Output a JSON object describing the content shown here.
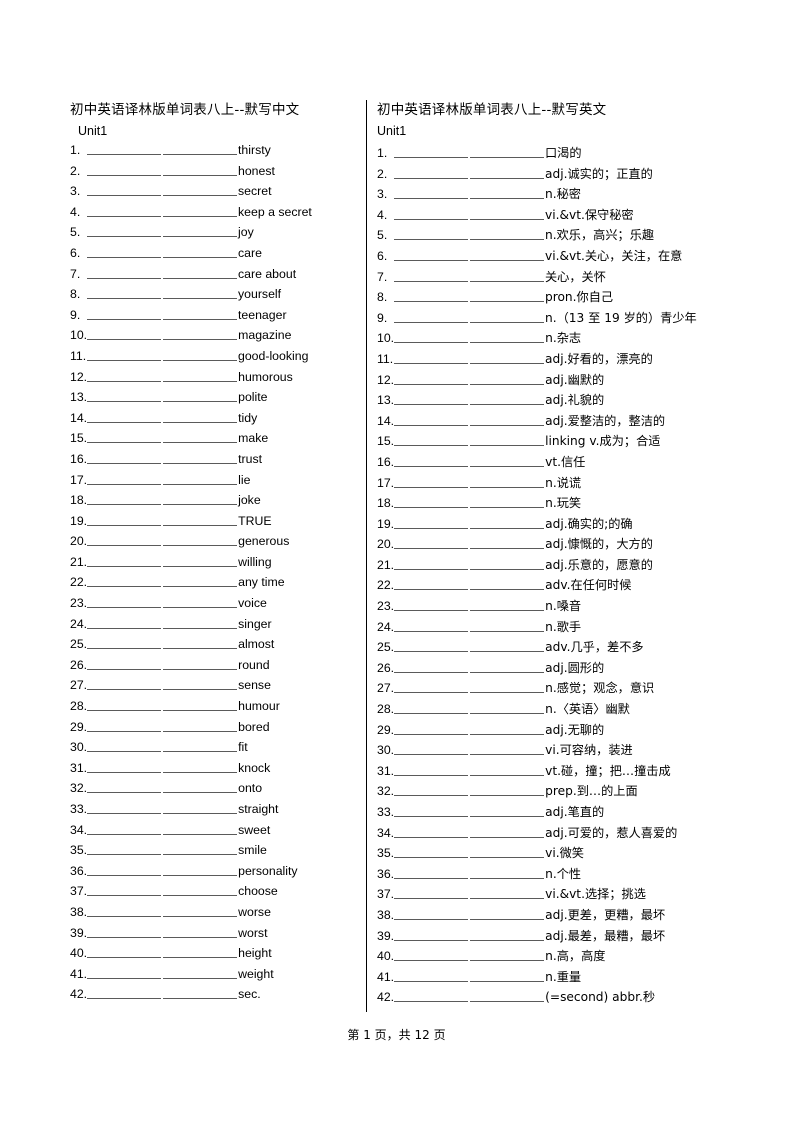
{
  "document": {
    "footer": "第 1 页，共 12 页"
  },
  "left_column": {
    "title": "初中英语译林版单词表八上--默写中文",
    "unit": "Unit1",
    "entries": [
      {
        "num": "1.",
        "text": "thirsty"
      },
      {
        "num": "2.",
        "text": "honest"
      },
      {
        "num": "3.",
        "text": "secret"
      },
      {
        "num": "4.",
        "text": "keep a secret"
      },
      {
        "num": "5.",
        "text": "joy"
      },
      {
        "num": "6.",
        "text": "care"
      },
      {
        "num": "7.",
        "text": "care about"
      },
      {
        "num": "8.",
        "text": "yourself"
      },
      {
        "num": "9.",
        "text": "teenager"
      },
      {
        "num": "10.",
        "text": "magazine"
      },
      {
        "num": "11.",
        "text": "good-looking"
      },
      {
        "num": "12.",
        "text": "humorous"
      },
      {
        "num": "13.",
        "text": "polite"
      },
      {
        "num": "14.",
        "text": "tidy"
      },
      {
        "num": "15.",
        "text": "make"
      },
      {
        "num": "16.",
        "text": "trust"
      },
      {
        "num": "17.",
        "text": "lie"
      },
      {
        "num": "18.",
        "text": "joke"
      },
      {
        "num": "19.",
        "text": "TRUE"
      },
      {
        "num": "20.",
        "text": "generous"
      },
      {
        "num": "21.",
        "text": "willing"
      },
      {
        "num": "22.",
        "text": "any time"
      },
      {
        "num": "23.",
        "text": "voice"
      },
      {
        "num": "24.",
        "text": "singer"
      },
      {
        "num": "25.",
        "text": "almost"
      },
      {
        "num": "26.",
        "text": "round"
      },
      {
        "num": "27.",
        "text": "sense"
      },
      {
        "num": "28.",
        "text": "humour"
      },
      {
        "num": "29.",
        "text": "bored"
      },
      {
        "num": "30.",
        "text": "fit"
      },
      {
        "num": "31.",
        "text": "knock"
      },
      {
        "num": "32.",
        "text": "onto"
      },
      {
        "num": "33.",
        "text": "straight"
      },
      {
        "num": "34.",
        "text": "sweet"
      },
      {
        "num": "35.",
        "text": "smile"
      },
      {
        "num": "36.",
        "text": "personality"
      },
      {
        "num": "37.",
        "text": "choose"
      },
      {
        "num": "38.",
        "text": "worse"
      },
      {
        "num": "39.",
        "text": "worst"
      },
      {
        "num": "40.",
        "text": "height"
      },
      {
        "num": "41.",
        "text": "weight"
      },
      {
        "num": "42.",
        "text": "sec."
      }
    ]
  },
  "right_column": {
    "title": "初中英语译林版单词表八上--默写英文",
    "unit": "Unit1",
    "entries": [
      {
        "num": "1.",
        "text": "口渴的"
      },
      {
        "num": "2.",
        "text": "adj.诚实的；正直的"
      },
      {
        "num": "3.",
        "text": "n.秘密"
      },
      {
        "num": "4.",
        "text": "vi.&vt.保守秘密"
      },
      {
        "num": "5.",
        "text": "n.欢乐，高兴；乐趣"
      },
      {
        "num": "6.",
        "text": "vi.&vt.关心，关注，在意"
      },
      {
        "num": "7.",
        "text": "关心，关怀"
      },
      {
        "num": "8.",
        "text": "pron.你自己"
      },
      {
        "num": "9.",
        "text": "n.（13 至 19 岁的）青少年"
      },
      {
        "num": "10.",
        "text": "n.杂志"
      },
      {
        "num": "11.",
        "text": "adj.好看的，漂亮的"
      },
      {
        "num": "12.",
        "text": "adj.幽默的"
      },
      {
        "num": "13.",
        "text": "adj.礼貌的"
      },
      {
        "num": "14.",
        "text": "adj.爱整洁的，整洁的"
      },
      {
        "num": "15.",
        "text": "linking v.成为；合适"
      },
      {
        "num": "16.",
        "text": "vt.信任"
      },
      {
        "num": "17.",
        "text": "n.说谎"
      },
      {
        "num": "18.",
        "text": "n.玩笑"
      },
      {
        "num": "19.",
        "text": "adj.确实的;的确"
      },
      {
        "num": "20.",
        "text": "adj.慷慨的，大方的"
      },
      {
        "num": "21.",
        "text": "adj.乐意的，愿意的"
      },
      {
        "num": "22.",
        "text": "adv.在任何时候"
      },
      {
        "num": "23.",
        "text": "n.嗓音"
      },
      {
        "num": "24.",
        "text": "n.歌手"
      },
      {
        "num": "25.",
        "text": "adv.几乎，差不多"
      },
      {
        "num": "26.",
        "text": "adj.圆形的"
      },
      {
        "num": "27.",
        "text": "n.感觉；观念，意识"
      },
      {
        "num": "28.",
        "text": "n.〈英语〉幽默"
      },
      {
        "num": "29.",
        "text": "adj.无聊的"
      },
      {
        "num": "30.",
        "text": "vi.可容纳，装进"
      },
      {
        "num": "31.",
        "text": "vt.碰，撞；把…撞击成"
      },
      {
        "num": "32.",
        "text": "prep.到…的上面"
      },
      {
        "num": "33.",
        "text": "adj.笔直的"
      },
      {
        "num": "34.",
        "text": "adj.可爱的，惹人喜爱的"
      },
      {
        "num": "35.",
        "text": "vi.微笑"
      },
      {
        "num": "36.",
        "text": "n.个性"
      },
      {
        "num": "37.",
        "text": "vi.&vt.选择；挑选"
      },
      {
        "num": "38.",
        "text": "adj.更差，更糟，最坏"
      },
      {
        "num": "39.",
        "text": "adj.最差，最糟，最坏"
      },
      {
        "num": "40.",
        "text": "n.高，高度"
      },
      {
        "num": "41.",
        "text": "n.重量"
      },
      {
        "num": "42.",
        "text": "(=second) abbr.秒"
      }
    ]
  }
}
